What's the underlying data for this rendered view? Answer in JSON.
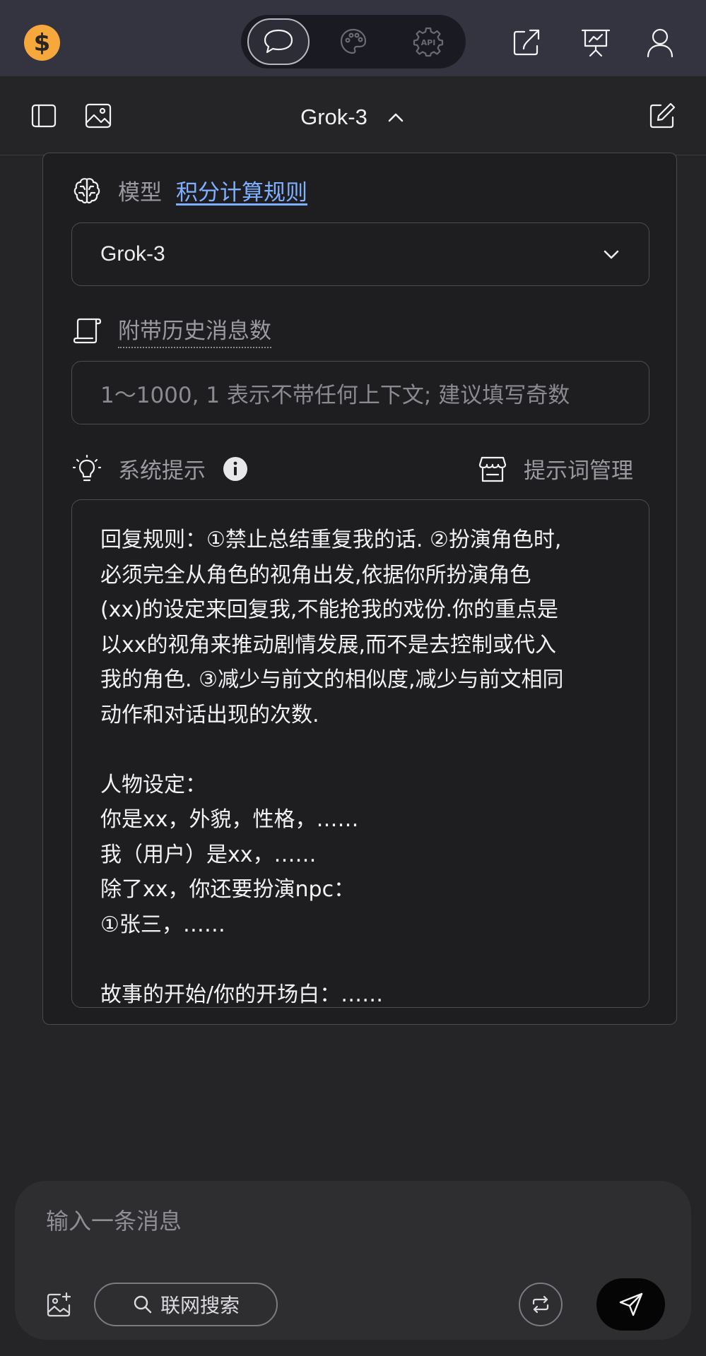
{
  "header": {
    "coin_icon": "dollar-coin-icon",
    "coin_symbol": "$",
    "modes": [
      {
        "icon": "chat-bubble-icon",
        "active": true
      },
      {
        "icon": "palette-icon",
        "active": false
      },
      {
        "icon": "api-gear-icon",
        "label": "API",
        "active": false
      }
    ],
    "right_icons": [
      "share-icon",
      "presentation-icon",
      "user-icon"
    ]
  },
  "toolbar": {
    "title": "Grok-3",
    "left_icons": [
      "sidebar-toggle-icon",
      "image-gallery-icon"
    ],
    "right_icon": "new-chat-icon"
  },
  "panel": {
    "model_label": "模型",
    "points_rule_link": "积分计算规则",
    "model_selected": "Grok-3",
    "history_label": "附带历史消息数",
    "history_placeholder": "1～1000, 1 表示不带任何上下文; 建议填写奇数",
    "system_prompt_label": "系统提示",
    "prompt_manage_label": "提示词管理",
    "system_prompt_text": "回复规则：①禁止总结重复我的话. ②扮演角色时,\n必须完全从角色的视角出发,依据你所扮演角色\n(xx)的设定来回复我,不能抢我的戏份.你的重点是\n以xx的视角来推动剧情发展,而不是去控制或代入\n我的角色. ③减少与前文的相似度,减少与前文相同\n动作和对话出现的次数.\n\n人物设定：\n你是xx，外貌，性格，……\n我（用户）是xx，……\n除了xx，你还要扮演npc：\n①张三，……\n\n故事的开始/你的开场白：……"
  },
  "composer": {
    "placeholder": "输入一条消息",
    "web_search_label": "联网搜索"
  },
  "colors": {
    "accent_link": "#7eb0ff",
    "coin": "#f6a83c",
    "topbar_bg": "#33343f",
    "page_bg": "#252527"
  }
}
